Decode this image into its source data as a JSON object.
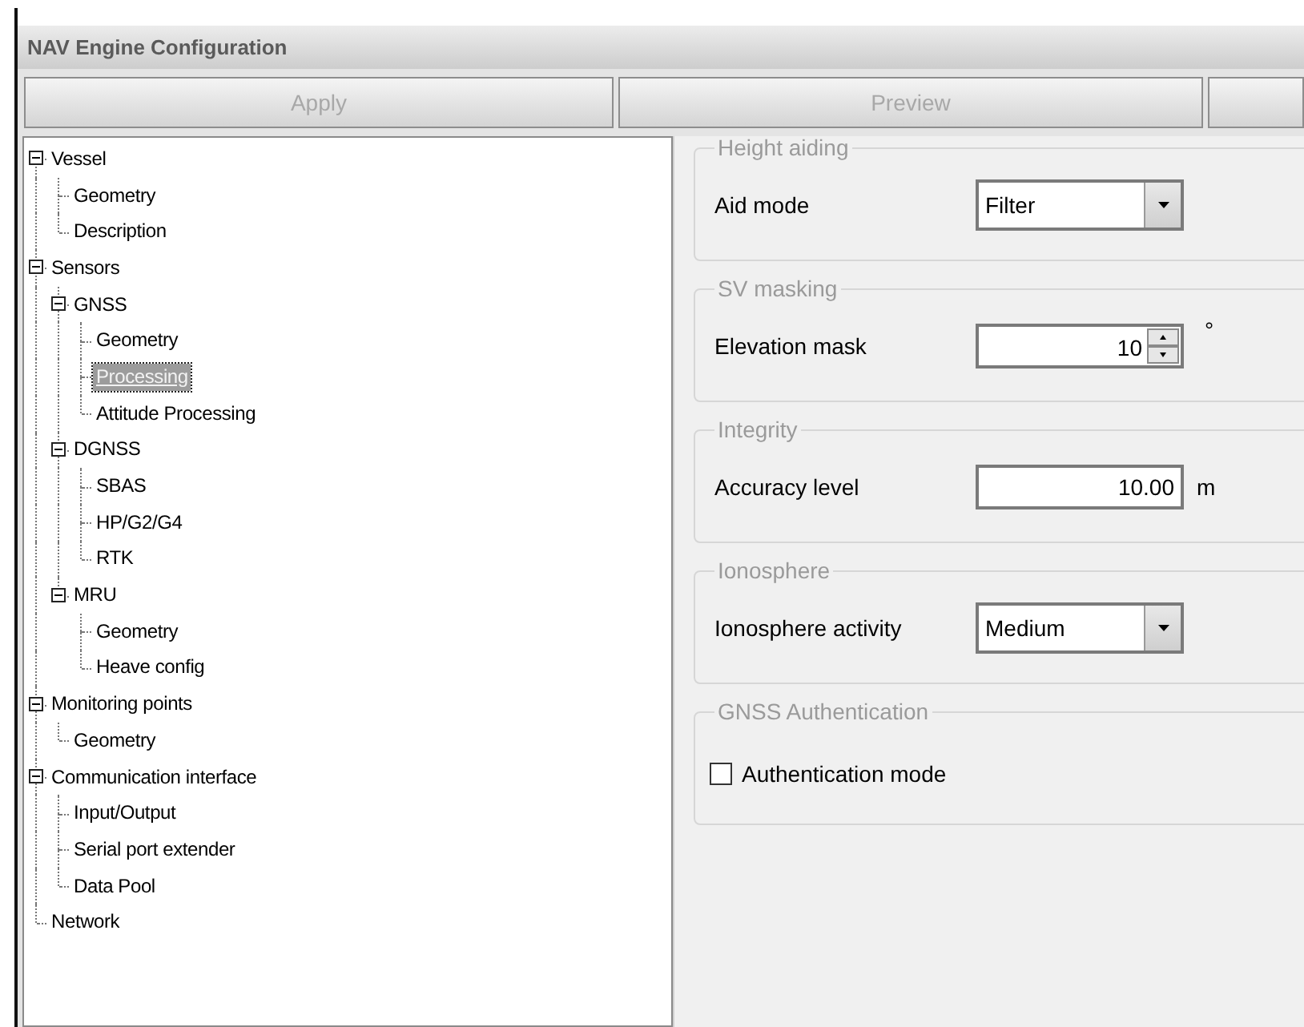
{
  "window": {
    "title": "NAV Engine Configuration"
  },
  "buttons": [
    {
      "label": "Apply",
      "disabled": true
    },
    {
      "label": "Preview",
      "disabled": true
    }
  ],
  "tree": [
    {
      "label": "Vessel",
      "selected": false,
      "expanded": true,
      "children": [
        {
          "label": "Geometry",
          "selected": false
        },
        {
          "label": "Description",
          "selected": false
        }
      ]
    },
    {
      "label": "Sensors",
      "selected": false,
      "expanded": true,
      "children": [
        {
          "label": "GNSS",
          "selected": false,
          "expanded": true,
          "children": [
            {
              "label": "Geometry",
              "selected": false
            },
            {
              "label": "Processing",
              "selected": true
            },
            {
              "label": "Attitude Processing",
              "selected": false
            }
          ]
        },
        {
          "label": "DGNSS",
          "selected": false,
          "expanded": true,
          "children": [
            {
              "label": "SBAS",
              "selected": false
            },
            {
              "label": "HP/G2/G4",
              "selected": false
            },
            {
              "label": "RTK",
              "selected": false
            }
          ]
        },
        {
          "label": "MRU",
          "selected": false,
          "expanded": true,
          "children": [
            {
              "label": "Geometry",
              "selected": false
            },
            {
              "label": "Heave config",
              "selected": false
            }
          ]
        }
      ]
    },
    {
      "label": "Monitoring points",
      "selected": false,
      "expanded": true,
      "children": [
        {
          "label": "Geometry",
          "selected": false
        }
      ]
    },
    {
      "label": "Communication interface",
      "selected": false,
      "expanded": true,
      "children": [
        {
          "label": "Input/Output",
          "selected": false
        },
        {
          "label": "Serial port extender",
          "selected": false
        },
        {
          "label": "Data Pool",
          "selected": false
        }
      ]
    },
    {
      "label": "Network",
      "selected": false
    }
  ],
  "groups": [
    {
      "title": "Height aiding",
      "fields": [
        {
          "kind": "dropdown",
          "label": "Aid mode",
          "value": "Filter"
        }
      ]
    },
    {
      "title": "SV masking",
      "fields": [
        {
          "kind": "spin",
          "label": "Elevation mask",
          "value": "10",
          "unit": "°"
        }
      ]
    },
    {
      "title": "Integrity",
      "fields": [
        {
          "kind": "number",
          "label": "Accuracy level",
          "value": "10.00",
          "unit": "m"
        }
      ]
    },
    {
      "title": "Ionosphere",
      "fields": [
        {
          "kind": "dropdown",
          "label": "Ionosphere activity",
          "value": "Medium"
        }
      ]
    },
    {
      "title": "GNSS Authentication",
      "fields": [
        {
          "kind": "checkbox",
          "label": "Authentication mode",
          "checked": false
        }
      ]
    }
  ]
}
